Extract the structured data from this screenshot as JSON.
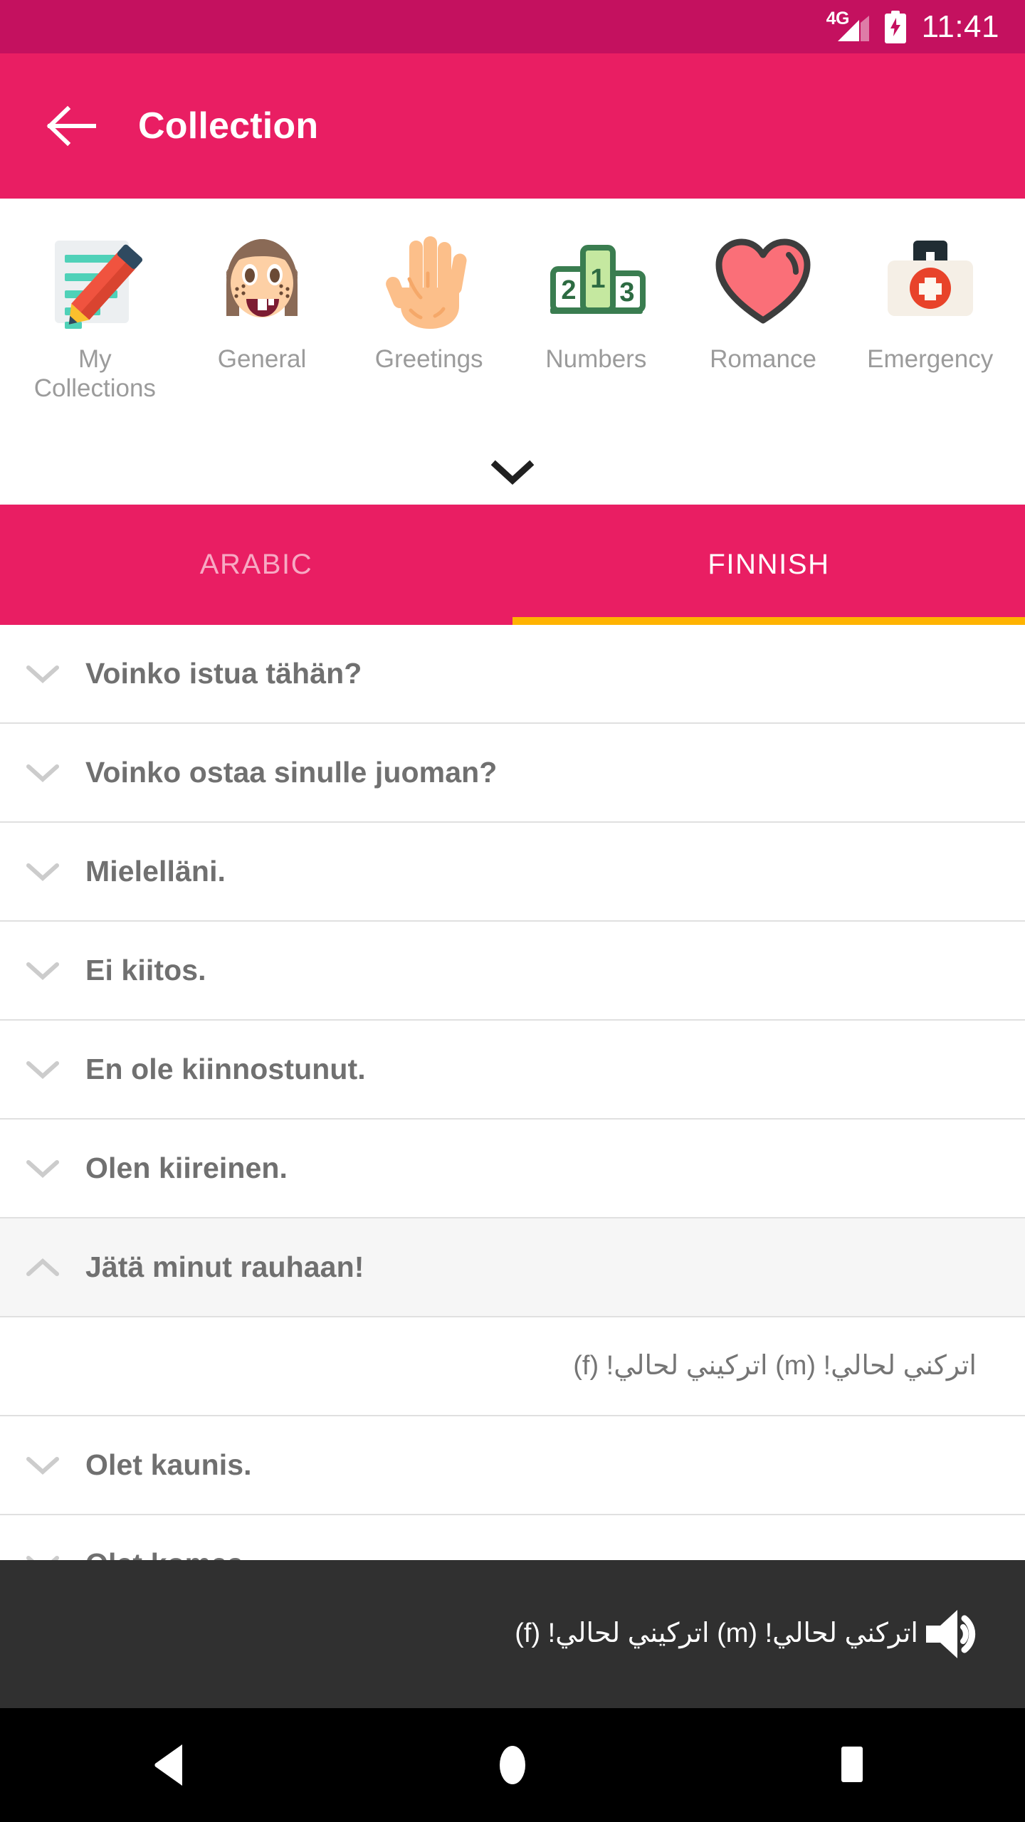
{
  "status_bar": {
    "network": "4G",
    "signal_icon": "signal-bars-icon",
    "battery_icon": "battery-charging-icon",
    "time": "11:41",
    "background_color": "#c4115f"
  },
  "app_bar": {
    "back_icon": "back-arrow-icon",
    "title": "Collection",
    "background_color": "#e91e63"
  },
  "categories": {
    "expand_icon": "chevron-down-icon",
    "items": [
      {
        "label": "My Collections",
        "icon": "memo-pencil-icon"
      },
      {
        "label": "General",
        "icon": "girl-face-icon"
      },
      {
        "label": "Greetings",
        "icon": "raised-hand-icon"
      },
      {
        "label": "Numbers",
        "icon": "podium-123-icon"
      },
      {
        "label": "Romance",
        "icon": "heart-icon"
      },
      {
        "label": "Emergency",
        "icon": "first-aid-kit-icon"
      }
    ]
  },
  "tabs": {
    "items": [
      {
        "label": "ARABIC",
        "active": false
      },
      {
        "label": "FINNISH",
        "active": true
      }
    ],
    "indicator_color": "#ffb300"
  },
  "phrase_list": {
    "collapsed_icon": "chevron-down-icon",
    "expanded_icon": "chevron-up-icon",
    "rows": [
      {
        "text": "Voinko istua tähän?",
        "expanded": false
      },
      {
        "text": "Voinko ostaa sinulle juoman?",
        "expanded": false
      },
      {
        "text": "Mielelläni.",
        "expanded": false
      },
      {
        "text": "Ei kiitos.",
        "expanded": false
      },
      {
        "text": "En ole kiinnostunut.",
        "expanded": false
      },
      {
        "text": "Olen kiireinen.",
        "expanded": false
      },
      {
        "text": "Jätä minut rauhaan!",
        "expanded": true
      },
      {
        "text": "Olet kaunis.",
        "expanded": false
      },
      {
        "text": "Olet komea.",
        "expanded": false
      }
    ],
    "expanded_translation": "اتركني لحالي! (m)  اتركيني لحالي! (f)"
  },
  "player": {
    "text": "اتركني لحالي! (m)  اتركيني لحالي! (f)",
    "speaker_icon": "speaker-volume-icon",
    "background_color": "#303030"
  },
  "nav_bar": {
    "back_icon": "nav-back-triangle-icon",
    "home_icon": "nav-home-circle-icon",
    "recents_icon": "nav-recents-square-icon"
  }
}
